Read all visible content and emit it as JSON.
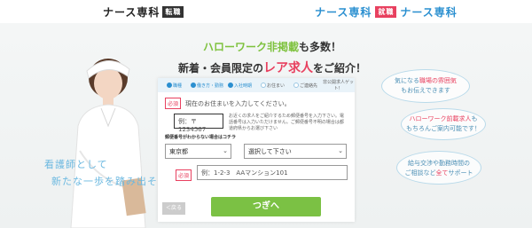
{
  "header": {
    "left_brand": "ナース専科",
    "left_badge": "転職",
    "right_brand_a": "ナース専科",
    "right_badge": "就職",
    "right_brand_b": "ナース専科"
  },
  "hero": {
    "headline_1a": "ハローワーク非掲載",
    "headline_1b": "も多数！",
    "headline_2a": "新着・会員限定の",
    "headline_2b": "レア求人",
    "headline_2c": "をご紹介！",
    "catch_1": "看護師として",
    "catch_2": "新たな一歩を踏み出そう"
  },
  "steps": [
    {
      "label": "職種"
    },
    {
      "label": "働き方・勤務"
    },
    {
      "label": "入社時期"
    },
    {
      "label": "お住まい"
    },
    {
      "label": "ご連絡先"
    },
    {
      "label": "非公開求人ゲット！"
    }
  ],
  "form": {
    "required_label": "必須",
    "instruction": "現在のお住まいを入力してください。",
    "zip_placeholder": "例：〒1234567",
    "zip_note": "お近くの求人をご紹介するため郵便番号を入力下さい。電話番号は入力いただけません。ご郵便番号不明の場合は都道府県からお選び下さい",
    "zip_unknown_note": "郵便番号がわからない場合はコチラ",
    "prefecture_value": "東京都",
    "city_value": "選択して下さい",
    "address_placeholder": "例：1-2-3　AAマンション101",
    "back_label": "＜戻る",
    "next_label": "つぎへ"
  },
  "bubbles": {
    "b1_pre": "気になる",
    "b1_hl": "職場の雰囲気",
    "b1_post": "もお伝えできます",
    "b2_hl": "ハローワーク",
    "b2_hl2": "前載求人",
    "b2_pre": "も",
    "b2_post": "もちろんご案内可能です！",
    "b3_pre": "給与交渉や勤務時間の",
    "b3_line2a": "ご相談など",
    "b3_hl": "全て",
    "b3_line2b": "サポート"
  },
  "icons": {
    "chevron": "chevron-down-icon",
    "nurse": "nurse-photo"
  },
  "colors": {
    "accent_green": "#7bc144",
    "accent_red": "#e8405f",
    "accent_blue": "#2a8fd0"
  }
}
